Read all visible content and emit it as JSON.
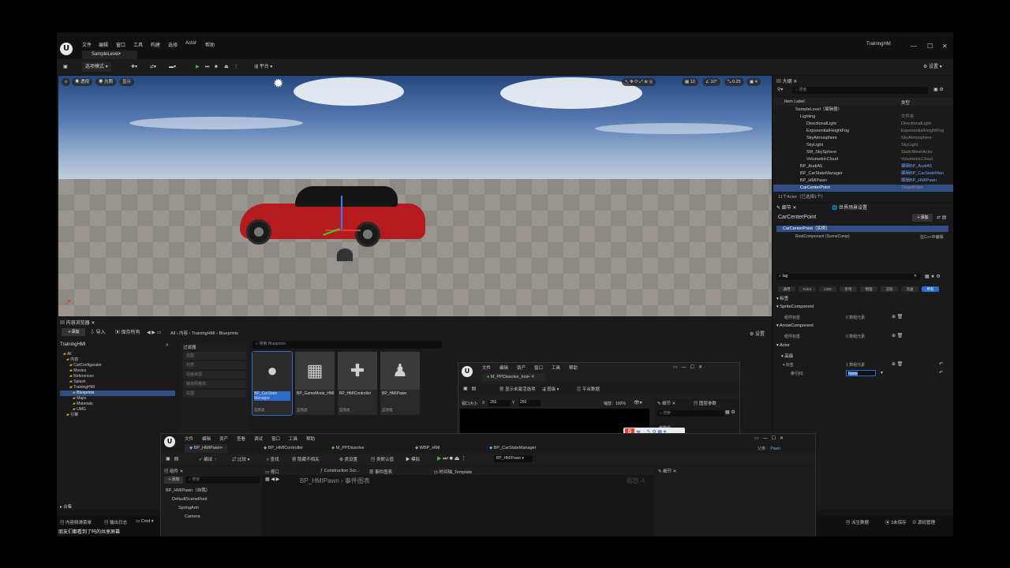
{
  "window": {
    "menu": [
      "文件",
      "编辑",
      "窗口",
      "工具",
      "构建",
      "选择",
      "Actor",
      "帮助"
    ],
    "level_tab": "SampleLevel•",
    "project_name": "TrainingHM",
    "settings_label": "设置"
  },
  "toolbar": {
    "select_mode": "选项模式",
    "platform": "平台"
  },
  "viewport": {
    "perspective": "透视",
    "lit": "光照",
    "show": "显示",
    "grid_snap": "10",
    "rot_snap": "10°",
    "scale_snap": "0.25",
    "camera_speed": "4"
  },
  "outliner": {
    "tab": "大纲",
    "search_placeholder": "搜索",
    "col_label": "Item Label",
    "col_type": "类型",
    "items": [
      {
        "label": "SampleLevel（编辑器）",
        "type": ""
      },
      {
        "label": "Lighting",
        "type": "文件夹"
      },
      {
        "label": "DirectionalLight",
        "type": "DirectionalLight"
      },
      {
        "label": "ExponentialHeightFog",
        "type": "ExponentialHeightFog"
      },
      {
        "label": "SkyAtmosphere",
        "type": "SkyAtmosphere"
      },
      {
        "label": "SkyLight",
        "type": "SkyLight"
      },
      {
        "label": "SM_SkySphere",
        "type": "StaticMeshActor"
      },
      {
        "label": "VolumetricCloud",
        "type": "VolumetricCloud"
      },
      {
        "label": "BP_AudiA5",
        "type": "编辑BP_AudiA5"
      },
      {
        "label": "BP_CarStateManager",
        "type": "编辑BP_CarStateMan"
      },
      {
        "label": "BP_HMIPawn",
        "type": "编辑BP_HMIPawn"
      },
      {
        "label": "CarCenterPoint",
        "type": "TargetPoint"
      }
    ],
    "status": "11个Actor（已选择1个）"
  },
  "details": {
    "tab": "细节",
    "world_settings_tab": "世界场景设置",
    "actor_name": "CarCenterPoint",
    "add_label": "添加",
    "instance": "CarCenterPoint（实例）",
    "root_component": "RootComponent (SceneComp)",
    "edit_cpp": "在C++中编辑",
    "search_value": "tag",
    "filters": [
      "通用",
      "Actor",
      "LOD",
      "杂项",
      "物理",
      "渲染",
      "流送",
      "所有"
    ],
    "sections": {
      "tags": "标签",
      "sprite": "SpriteComponent",
      "arrow": "ArrowComponent",
      "actor": "Actor",
      "advanced": "高级"
    },
    "component_tags": "组件标签",
    "tags_label": "标签",
    "index0": "索引[0]",
    "array_empty": "0 数组元素",
    "array_one": "1 数组元素",
    "none_value": "None"
  },
  "content_browser": {
    "tab": "内容浏览器",
    "add": "添加",
    "import": "导入",
    "save_all": "保存所有",
    "path": [
      "All",
      "内容",
      "TrainingHMI",
      "Blueprints"
    ],
    "settings": "设置",
    "root": "TrainingHMI",
    "tree": [
      "All",
      "内容",
      "CarConfigurator",
      "Movies",
      "References",
      "Splash",
      "TrainingHMI",
      "Blueprints",
      "Maps",
      "Materials",
      "UMG",
      "引擎"
    ],
    "filters_title": "过滤器",
    "filter_items": [
      "蓝图",
      "材质",
      "动画资源",
      "静态网格体",
      "纹理"
    ],
    "search_placeholder": "搜索 Blueprints",
    "assets": [
      {
        "name": "BP_CarState Manager",
        "type": "蓝图类"
      },
      {
        "name": "BP_GameMode_HMI",
        "type": "蓝图类"
      },
      {
        "name": "BP_HMIController",
        "type": "蓝图类"
      },
      {
        "name": "BP_HMIPawn",
        "type": "蓝图类"
      }
    ],
    "collections": "合集"
  },
  "bottom_bar": {
    "drawer": "内容侧滑菜单",
    "output": "输出日志",
    "cmd": "Cmd",
    "subtitle": "朋友们都看到了吗的共享屏幕",
    "derived": "派生数据",
    "unsaved": "3未保存",
    "source_control": "源码管理"
  },
  "material_window": {
    "menu": [
      "文件",
      "编辑",
      "资产",
      "窗口",
      "工具",
      "帮助"
    ],
    "tab": "M_PPDissolve_Inst•",
    "show_inherited": "显示未激活选项",
    "hierarchy": "层级",
    "platform_stats": "平台数据",
    "viewport_size": "视口大小",
    "x_label": "X",
    "x_value": "250",
    "y_label": "Y",
    "y_value": "250",
    "zoom": "缩放：100%",
    "details_tab": "细节",
    "params_tab": "图层参数",
    "search": "搜索",
    "param_group": "参数组"
  },
  "blueprint_window": {
    "menu": [
      "文件",
      "编辑",
      "资产",
      "查看",
      "调试",
      "窗口",
      "工具",
      "帮助"
    ],
    "tabs": [
      "BP_HMIPawn•",
      "BP_HMIController",
      "M_PPDissolve",
      "WBP_HMI",
      "BP_CarStateManager"
    ],
    "parent": "父类：",
    "parent_value": "Pawn",
    "compile": "编译",
    "diff": "比较",
    "find": "查找",
    "hide_unrelated": "隐藏不相关",
    "class_settings": "类设置",
    "class_defaults": "类默认值",
    "simulate": "模拟",
    "debug_object": "BP_HMIPawn",
    "components_tab": "组件",
    "add": "添加",
    "search": "搜索",
    "components": [
      "BP_HMIPawn（自我）",
      "DefaultSceneRoot",
      "SpringArm",
      "Camera"
    ],
    "viewport_tab": "视口",
    "construction_tab": "Construction Scr...",
    "event_graph_tab": "事件图表",
    "timeline_tab": "时间轴_Template",
    "breadcrumb_root": "BP_HMIPawn",
    "breadcrumb_leaf": "事件图表",
    "zoom": "缩放-4",
    "details_tab": "细节"
  },
  "ime": {
    "label": "英"
  }
}
